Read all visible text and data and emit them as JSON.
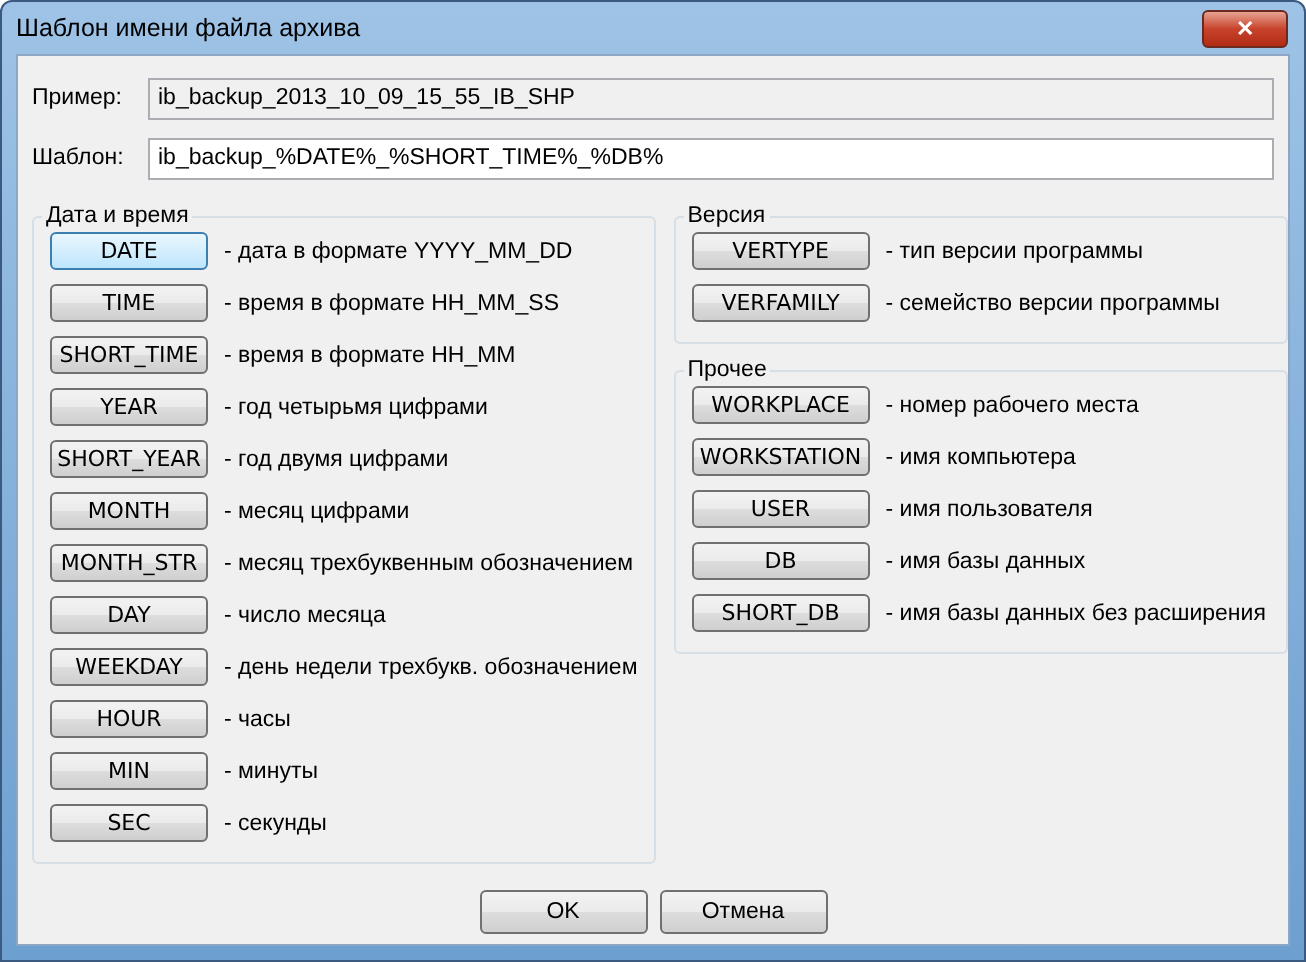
{
  "window": {
    "title": "Шаблон имени файла архива",
    "close": "✕"
  },
  "example": {
    "label": "Пример:",
    "value": "ib_backup_2013_10_09_15_55_IB_SHP"
  },
  "template": {
    "label": "Шаблон:",
    "value": "ib_backup_%DATE%_%SHORT_TIME%_%DB%"
  },
  "groups": [
    {
      "title": "Дата и время",
      "items": [
        {
          "token": "DATE",
          "description": "- дата в формате YYYY_MM_DD",
          "selected": true
        },
        {
          "token": "TIME",
          "description": "- время в формате HH_MM_SS",
          "selected": false
        },
        {
          "token": "SHORT_TIME",
          "description": "- время в формате HH_MM",
          "selected": false
        },
        {
          "token": "YEAR",
          "description": "- год четырьмя цифрами",
          "selected": false
        },
        {
          "token": "SHORT_YEAR",
          "description": "- год двумя цифрами",
          "selected": false
        },
        {
          "token": "MONTH",
          "description": "- месяц цифрами",
          "selected": false
        },
        {
          "token": "MONTH_STR",
          "description": "- месяц трехбуквенным обозначением",
          "selected": false
        },
        {
          "token": "DAY",
          "description": "- число месяца",
          "selected": false
        },
        {
          "token": "WEEKDAY",
          "description": "- день недели трехбукв. обозначением",
          "selected": false
        },
        {
          "token": "HOUR",
          "description": "- часы",
          "selected": false
        },
        {
          "token": "MIN",
          "description": "- минуты",
          "selected": false
        },
        {
          "token": "SEC",
          "description": "- секунды",
          "selected": false
        }
      ]
    },
    {
      "title": "Версия",
      "items": [
        {
          "token": "VERTYPE",
          "description": "- тип версии программы",
          "selected": false
        },
        {
          "token": "VERFAMILY",
          "description": "- семейство версии программы",
          "selected": false
        }
      ]
    },
    {
      "title": "Прочее",
      "items": [
        {
          "token": "WORKPLACE",
          "description": "- номер рабочего места",
          "selected": false
        },
        {
          "token": "WORKSTATION",
          "description": "- имя компьютера",
          "selected": false
        },
        {
          "token": "USER",
          "description": "- имя пользователя",
          "selected": false
        },
        {
          "token": "DB",
          "description": "- имя базы данных",
          "selected": false
        },
        {
          "token": "SHORT_DB",
          "description": "- имя базы данных без расширения",
          "selected": false
        }
      ]
    }
  ],
  "buttons": [
    "OK",
    "Отмена"
  ]
}
